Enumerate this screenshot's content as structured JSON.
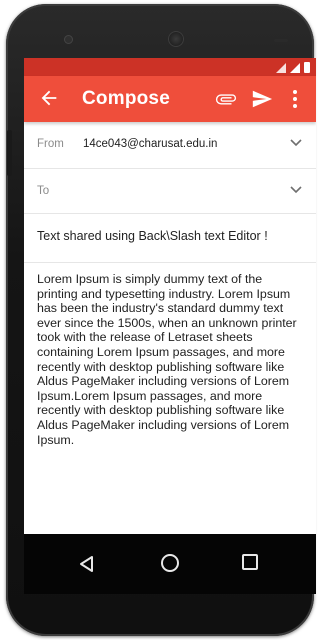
{
  "appbar": {
    "title": "Compose",
    "icons": [
      "back-arrow-icon",
      "attach-icon",
      "send-icon",
      "more-vert-icon"
    ],
    "color": "#ef4e3b",
    "statusbar_color": "#cc3226"
  },
  "from": {
    "label": "From",
    "value": "14ce043@charusat.edu.in"
  },
  "to": {
    "label": "To",
    "value": ""
  },
  "subject": {
    "value": "Text shared using Back\\Slash text Editor !"
  },
  "body": {
    "text": "Lorem Ipsum is simply dummy text of the\nprinting and typesetting industry. Lorem Ipsum\nhas been the industry's standard dummy text\never since the 1500s, when an unknown printer\ntook with the release of Letraset sheets\ncontaining Lorem Ipsum passages, and more\nrecently with desktop publishing software like\nAldus PageMaker including versions of Lorem\nIpsum.Lorem Ipsum passages, and more\nrecently with desktop publishing software like\nAldus PageMaker including versions of Lorem\nIpsum."
  },
  "navbar": {
    "icons": [
      "nav-back-icon",
      "nav-home-icon",
      "nav-recents-icon"
    ]
  }
}
